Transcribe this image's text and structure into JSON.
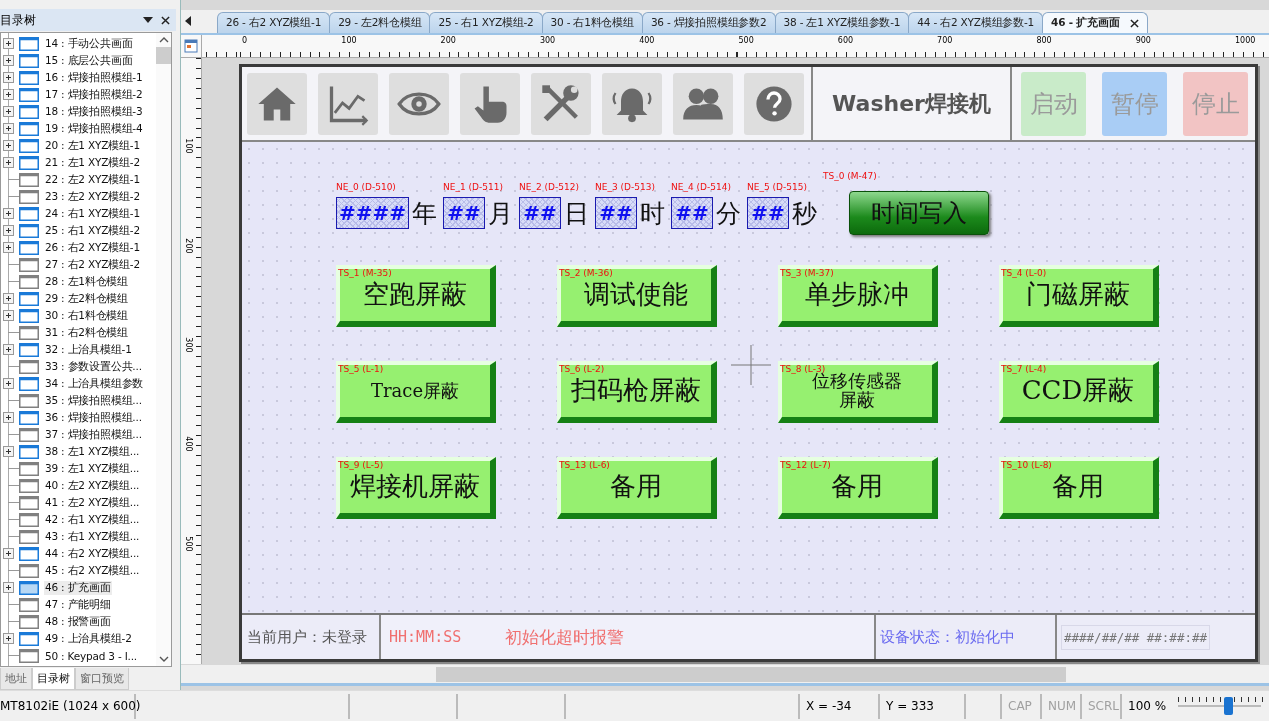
{
  "side_panel": {
    "title": "目录树",
    "tree": [
      {
        "label": "14 : 手动公共画面",
        "expandable": true,
        "selected": false
      },
      {
        "label": "15 : 底层公共画面",
        "expandable": true,
        "selected": false
      },
      {
        "label": "16 : 焊接拍照模组-1",
        "expandable": true,
        "selected": false
      },
      {
        "label": "17 : 焊接拍照模组-2",
        "expandable": true,
        "selected": false
      },
      {
        "label": "18 : 焊接拍照模组-3",
        "expandable": true,
        "selected": false
      },
      {
        "label": "19 : 焊接拍照模组-4",
        "expandable": true,
        "selected": false
      },
      {
        "label": "20 : 左1 XYZ模组-1",
        "expandable": true,
        "selected": false
      },
      {
        "label": "21 : 左1 XYZ模组-2",
        "expandable": true,
        "selected": false
      },
      {
        "label": "22 : 左2 XYZ模组-1",
        "expandable": false,
        "selected": false
      },
      {
        "label": "23 : 左2 XYZ模组-2",
        "expandable": false,
        "selected": false
      },
      {
        "label": "24 : 右1 XYZ模组-1",
        "expandable": true,
        "selected": false
      },
      {
        "label": "25 : 右1 XYZ模组-2",
        "expandable": true,
        "selected": false
      },
      {
        "label": "26 : 右2 XYZ模组-1",
        "expandable": true,
        "selected": false
      },
      {
        "label": "27 : 右2 XYZ模组-2",
        "expandable": false,
        "selected": false
      },
      {
        "label": "28 : 左1料仓模组",
        "expandable": false,
        "selected": false
      },
      {
        "label": "29 : 左2料仓模组",
        "expandable": true,
        "selected": false
      },
      {
        "label": "30 : 右1料仓模组",
        "expandable": true,
        "selected": false
      },
      {
        "label": "31 : 右2料仓模组",
        "expandable": false,
        "selected": false
      },
      {
        "label": "32 : 上治具模组-1",
        "expandable": true,
        "selected": false
      },
      {
        "label": "33 : 参数设置公共...",
        "expandable": false,
        "selected": false
      },
      {
        "label": "34 : 上治具模组参数",
        "expandable": true,
        "selected": false
      },
      {
        "label": "35 : 焊接拍照模组...",
        "expandable": false,
        "selected": false
      },
      {
        "label": "36 : 焊接拍照模组...",
        "expandable": true,
        "selected": false
      },
      {
        "label": "37 : 焊接拍照模组...",
        "expandable": false,
        "selected": false
      },
      {
        "label": "38 : 左1 XYZ模组...",
        "expandable": true,
        "selected": false
      },
      {
        "label": "39 : 左1 XYZ模组...",
        "expandable": false,
        "selected": false
      },
      {
        "label": "40 : 左2 XYZ模组...",
        "expandable": false,
        "selected": false
      },
      {
        "label": "41 : 左2 XYZ模组...",
        "expandable": false,
        "selected": false
      },
      {
        "label": "42 : 右1 XYZ模组...",
        "expandable": false,
        "selected": false
      },
      {
        "label": "43 : 右1 XYZ模组...",
        "expandable": false,
        "selected": false
      },
      {
        "label": "44 : 右2 XYZ模组...",
        "expandable": true,
        "selected": false
      },
      {
        "label": "45 : 右2 XYZ模组...",
        "expandable": false,
        "selected": false
      },
      {
        "label": "46 : 扩充画面",
        "expandable": true,
        "selected": true
      },
      {
        "label": "47 : 产能明细",
        "expandable": false,
        "selected": false
      },
      {
        "label": "48 : 报警画面",
        "expandable": false,
        "selected": false
      },
      {
        "label": "49 : 上治具模组-2",
        "expandable": true,
        "selected": false
      },
      {
        "label": "50 : Keypad 3 - I...",
        "expandable": false,
        "selected": false
      }
    ],
    "tabs": [
      {
        "label": "地址",
        "selected": false
      },
      {
        "label": "目录树",
        "selected": true
      },
      {
        "label": "窗口预览",
        "selected": false
      }
    ]
  },
  "tabs": [
    {
      "label": "26 - 右2 XYZ模组-1",
      "selected": false
    },
    {
      "label": "29 - 左2料仓模组",
      "selected": false
    },
    {
      "label": "25 - 右1 XYZ模组-2",
      "selected": false
    },
    {
      "label": "30 - 右1料仓模组",
      "selected": false
    },
    {
      "label": "36 - 焊接拍照模组参数2",
      "selected": false
    },
    {
      "label": "38 - 左1 XYZ模组参数-1",
      "selected": false
    },
    {
      "label": "44 - 右2 XYZ模组参数-1",
      "selected": false
    },
    {
      "label": "46 - 扩充画面",
      "selected": true
    }
  ],
  "ruler": {
    "h_labels": [
      "0",
      "100",
      "200",
      "300",
      "400",
      "500",
      "600",
      "700",
      "800",
      "900",
      "1000"
    ],
    "v_labels": [
      "100",
      "200",
      "300",
      "400",
      "500"
    ]
  },
  "screen": {
    "toolbar_icons": [
      {
        "kind": "home"
      },
      {
        "kind": "chart"
      },
      {
        "kind": "eye"
      },
      {
        "kind": "hand"
      },
      {
        "kind": "tools"
      },
      {
        "kind": "bell"
      },
      {
        "kind": "users"
      },
      {
        "kind": "help"
      }
    ],
    "title": "Washer焊接机",
    "control_buttons": [
      {
        "label": "启动",
        "color": "#c9ebc9"
      },
      {
        "label": "暂停",
        "color": "#a9cdf5"
      },
      {
        "label": "停止",
        "color": "#f2c4c4"
      }
    ],
    "date_fields": [
      {
        "tag": "NE_0 (D-510)",
        "value": "####",
        "unit": "年"
      },
      {
        "tag": "NE_1 (D-511)",
        "value": "##",
        "unit": "月"
      },
      {
        "tag": "NE_2 (D-512)",
        "value": "##",
        "unit": "日"
      },
      {
        "tag": "NE_3 (D-513)",
        "value": "##",
        "unit": "时"
      },
      {
        "tag": "NE_4 (D-514)",
        "value": "##",
        "unit": "分"
      },
      {
        "tag": "NE_5 (D-515)",
        "value": "##",
        "unit": "秒"
      }
    ],
    "write_button": {
      "tag": "TS_0 (M-47)",
      "label": "时间写入"
    },
    "toggle_buttons": [
      {
        "tag": "TS_1 (M-35)",
        "label": "空跑屏蔽"
      },
      {
        "tag": "TS_2 (M-36)",
        "label": "调试使能"
      },
      {
        "tag": "TS_3 (M-37)",
        "label": "单步脉冲"
      },
      {
        "tag": "TS_4 (L-0)",
        "label": "门磁屏蔽"
      },
      {
        "tag": "TS_5 (L-1)",
        "label": "Trace屏蔽"
      },
      {
        "tag": "TS_6 (L-2)",
        "label": "扫码枪屏蔽"
      },
      {
        "tag": "TS_8 (L-3)",
        "label": "位移传感器屏蔽"
      },
      {
        "tag": "TS_7 (L-4)",
        "label": "CCD屏蔽"
      },
      {
        "tag": "TS_9 (L-5)",
        "label": "焊接机屏蔽"
      },
      {
        "tag": "TS_13 (L-6)",
        "label": "备用"
      },
      {
        "tag": "TS_12 (L-7)",
        "label": "备用"
      },
      {
        "tag": "TS_10 (L-8)",
        "label": "备用"
      }
    ],
    "footer": {
      "user": "当前用户：未登录",
      "time": "HH:MM:SS",
      "alarm": "初始化超时报警",
      "status": "设备状态：初始化中",
      "datetime": "####/##/## ##:##:##"
    }
  },
  "status_bar": {
    "model": "MT8102iE (1024 x 600)",
    "x": "X = -34",
    "y": "Y = 333",
    "keys": [
      {
        "label": "CAP",
        "on": false
      },
      {
        "label": "NUM",
        "on": false
      },
      {
        "label": "SCRL",
        "on": false
      }
    ],
    "zoom": "100 %",
    "zoom_slider": {
      "level": 0.6
    }
  }
}
